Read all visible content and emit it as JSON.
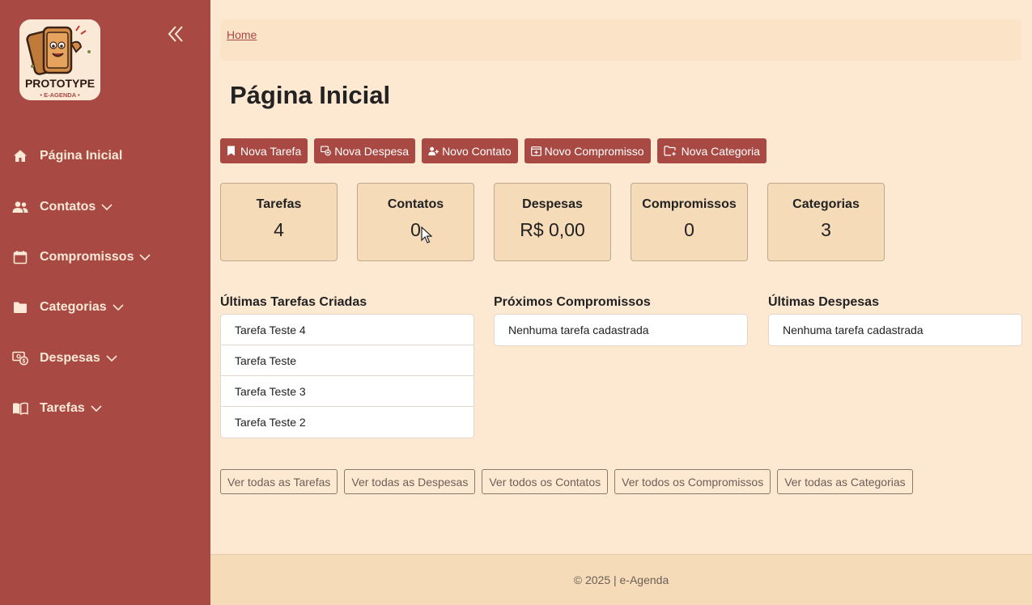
{
  "app": {
    "logo_text": "PROTOTYPE",
    "logo_subtext": "• E-AGENDA •"
  },
  "sidebar": {
    "items": [
      {
        "label": "Página Inicial",
        "icon": "home-icon",
        "has_chevron": false
      },
      {
        "label": "Contatos",
        "icon": "people-icon",
        "has_chevron": true
      },
      {
        "label": "Compromissos",
        "icon": "calendar-icon",
        "has_chevron": true
      },
      {
        "label": "Categorias",
        "icon": "folder-icon",
        "has_chevron": true
      },
      {
        "label": "Despesas",
        "icon": "cash-icon",
        "has_chevron": true
      },
      {
        "label": "Tarefas",
        "icon": "book-icon",
        "has_chevron": true
      }
    ]
  },
  "breadcrumb": {
    "home": "Home"
  },
  "page": {
    "title": "Página Inicial"
  },
  "actions": [
    {
      "label": "Nova Tarefa",
      "icon": "bookmark-icon"
    },
    {
      "label": "Nova Despesa",
      "icon": "cash-plus-icon"
    },
    {
      "label": "Novo Contato",
      "icon": "person-plus-icon"
    },
    {
      "label": "Novo Compromisso",
      "icon": "calendar-plus-icon"
    },
    {
      "label": "Nova Categoria",
      "icon": "folder-plus-icon"
    }
  ],
  "cards": [
    {
      "title": "Tarefas",
      "value": "4"
    },
    {
      "title": "Contatos",
      "value": "0"
    },
    {
      "title": "Despesas",
      "value": "R$ 0,00"
    },
    {
      "title": "Compromissos",
      "value": "0"
    },
    {
      "title": "Categorias",
      "value": "3"
    }
  ],
  "lists": {
    "tarefas": {
      "title": "Últimas Tarefas Criadas",
      "items": [
        "Tarefa Teste 4",
        "Tarefa Teste",
        "Tarefa Teste 3",
        "Tarefa Teste 2"
      ]
    },
    "compromissos": {
      "title": "Próximos Compromissos",
      "items": [
        "Nenhuma tarefa cadastrada"
      ]
    },
    "despesas": {
      "title": "Últimas Despesas",
      "items": [
        "Nenhuma tarefa cadastrada"
      ]
    }
  },
  "links": [
    "Ver todas as Tarefas",
    "Ver todas as Despesas",
    "Ver todos os Contatos",
    "Ver todos os Compromissos",
    "Ver todas as Categorias"
  ],
  "footer": {
    "text": "© 2025 | e-Agenda"
  },
  "colors": {
    "sidebar": "#a84a43",
    "background": "#fde9d2",
    "card": "#f5dbb8",
    "accent_text": "#fbe9d8"
  }
}
